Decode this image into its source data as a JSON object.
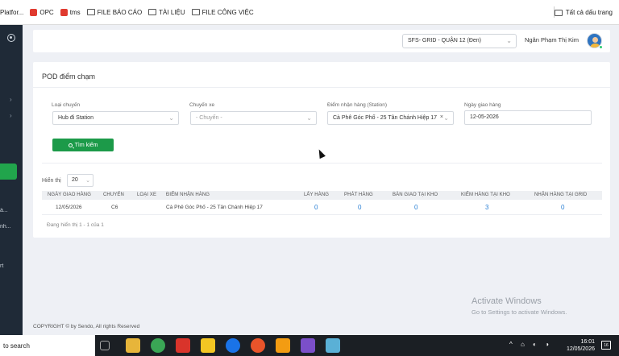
{
  "browser": {
    "bookmarks": [
      {
        "label": "Platfor...",
        "icon": "page-icon"
      },
      {
        "label": "OPC",
        "icon": "app-icon"
      },
      {
        "label": "tms",
        "icon": "app-icon"
      },
      {
        "label": "FILE BÁO CÁO",
        "icon": "folder-icon"
      },
      {
        "label": "TÀI LIỆU",
        "icon": "folder-icon"
      },
      {
        "label": "FILE CÔNG VIỆC",
        "icon": "folder-icon"
      }
    ],
    "all_bookmarks": "Tất cả dấu trang"
  },
  "sidebar": {
    "items": [
      "á...",
      "nh...",
      "rt"
    ]
  },
  "header": {
    "region_select": "SFS- GRID - QUẬN 12 (Đen)",
    "user_name": "Ngân Phạm Thị Kim"
  },
  "card": {
    "title": "POD điểm chạm",
    "filters": {
      "route_type": {
        "label": "Loại chuyến",
        "value": "Hub đi Station"
      },
      "trip": {
        "label": "Chuyến xe",
        "value": "- Chuyến -"
      },
      "station": {
        "label": "Điểm nhận hàng (Station)",
        "value": "Cà Phê Góc Phố - 25 Tân Chánh Hiệp 17"
      },
      "date": {
        "label": "Ngày giao hàng",
        "value": "12-05-2026"
      }
    },
    "search_button": "Tìm kiếm",
    "page_size": {
      "label": "Hiển thị",
      "value": "20"
    },
    "table": {
      "headers": [
        "NGÀY GIAO HÀNG",
        "CHUYẾN",
        "LOẠI XE",
        "ĐIỂM NHẬN HÀNG",
        "LẤY HÀNG",
        "PHÁT HÀNG",
        "BÀN GIAO TẠI KHO",
        "KIỂM HÀNG TẠI KHO",
        "NHẬN HÀNG TẠI GRID"
      ],
      "rows": [
        {
          "date": "12/05/2026",
          "trip": "C6",
          "vehicle": "",
          "station": "Cà Phê Góc Phố - 25 Tân Chánh Hiệp 17",
          "pickup": "0",
          "delivery": "0",
          "handover": "0",
          "check": "3",
          "receive": "0"
        }
      ]
    },
    "pagination_info": "Đang hiển thị 1 - 1 của 1"
  },
  "footer": {
    "copyright": "COPYRIGHT © by Sendo, All rights Reserved"
  },
  "watermark": {
    "title": "Activate Windows",
    "subtitle": "Go to Settings to activate Windows."
  },
  "taskbar": {
    "search": "to search",
    "time": "16:01",
    "date": "12/05/2026",
    "notify_count": "16"
  },
  "colors": {
    "accent_green": "#1c9a49",
    "sidebar": "#1f2a37",
    "link_blue": "#2a7fd4"
  }
}
